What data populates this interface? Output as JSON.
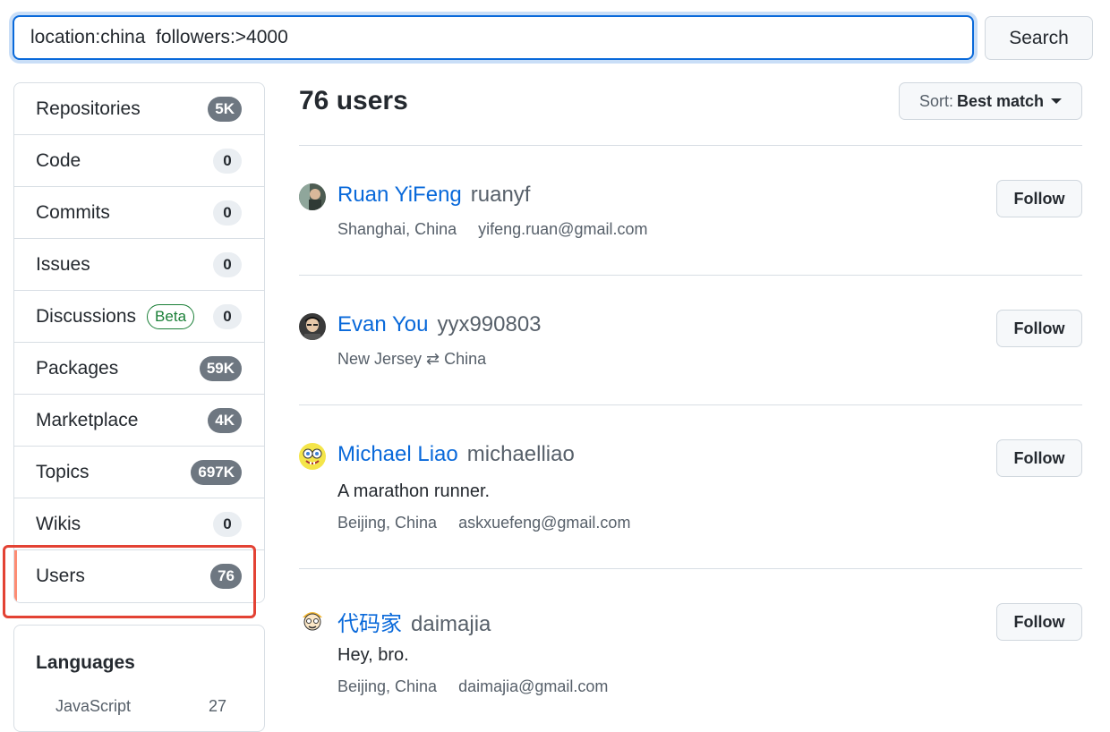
{
  "search": {
    "query": "location:china  followers:>4000",
    "button_label": "Search"
  },
  "sidebar": {
    "items": [
      {
        "label": "Repositories",
        "count": "5K"
      },
      {
        "label": "Code",
        "count": "0"
      },
      {
        "label": "Commits",
        "count": "0"
      },
      {
        "label": "Issues",
        "count": "0"
      },
      {
        "label": "Discussions",
        "badge": "Beta",
        "count": "0"
      },
      {
        "label": "Packages",
        "count": "59K"
      },
      {
        "label": "Marketplace",
        "count": "4K"
      },
      {
        "label": "Topics",
        "count": "697K"
      },
      {
        "label": "Wikis",
        "count": "0"
      },
      {
        "label": "Users",
        "count": "76"
      }
    ],
    "selected": "Users"
  },
  "languages": {
    "title": "Languages",
    "items": [
      {
        "name": "JavaScript",
        "count": "27"
      }
    ]
  },
  "results": {
    "title": "76 users",
    "sort_prefix": "Sort:",
    "sort_value": "Best match",
    "follow_label": "Follow",
    "users": [
      {
        "name": "Ruan YiFeng",
        "login": "ruanyf",
        "bio": "",
        "location": "Shanghai, China",
        "email": "yifeng.ruan@gmail.com"
      },
      {
        "name": "Evan You",
        "login": "yyx990803",
        "bio": "",
        "location": "New Jersey ⇄ China",
        "email": ""
      },
      {
        "name": "Michael Liao",
        "login": "michaelliao",
        "bio": "A marathon runner.",
        "location": "Beijing, China",
        "email": "askxuefeng@gmail.com"
      },
      {
        "name": "代码家",
        "login": "daimajia",
        "bio": "Hey, bro.",
        "location": "Beijing, China",
        "email": "daimajia@gmail.com"
      }
    ]
  },
  "colors": {
    "link": "#0969da",
    "selected_accent": "#fd8c73",
    "highlight_annotation": "#e34234",
    "beta_green": "#1a7f37",
    "focus_border": "#0969da"
  }
}
